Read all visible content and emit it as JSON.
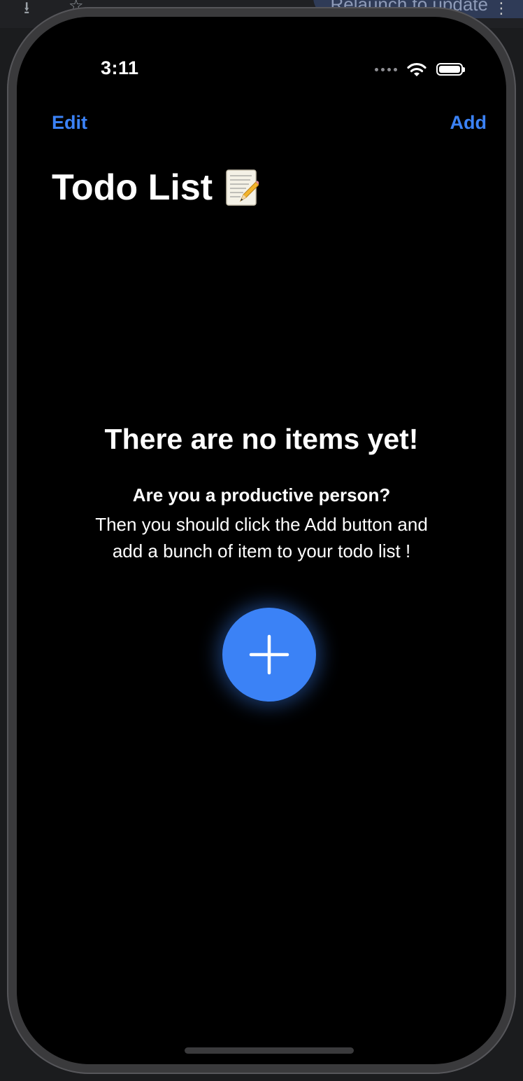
{
  "browser": {
    "relaunch_label": "Relaunch to update",
    "menu_icon": "kebab-menu-icon"
  },
  "status_bar": {
    "time": "3:11",
    "icons": [
      "signal-dots-icon",
      "wifi-icon",
      "battery-icon"
    ]
  },
  "nav": {
    "left_label": "Edit",
    "right_label": "Add"
  },
  "title": {
    "text": "Todo List",
    "emoji_icon": "memo-icon"
  },
  "empty_state": {
    "heading": "There are no items yet!",
    "subheading": "Are you a productive person?",
    "body_line_1": "Then you should click the Add button and",
    "body_line_2": "add a bunch of item to your todo list !",
    "fab_icon": "plus-icon"
  },
  "colors": {
    "accent": "#3b82f6",
    "background": "#000000",
    "text": "#ffffff"
  }
}
